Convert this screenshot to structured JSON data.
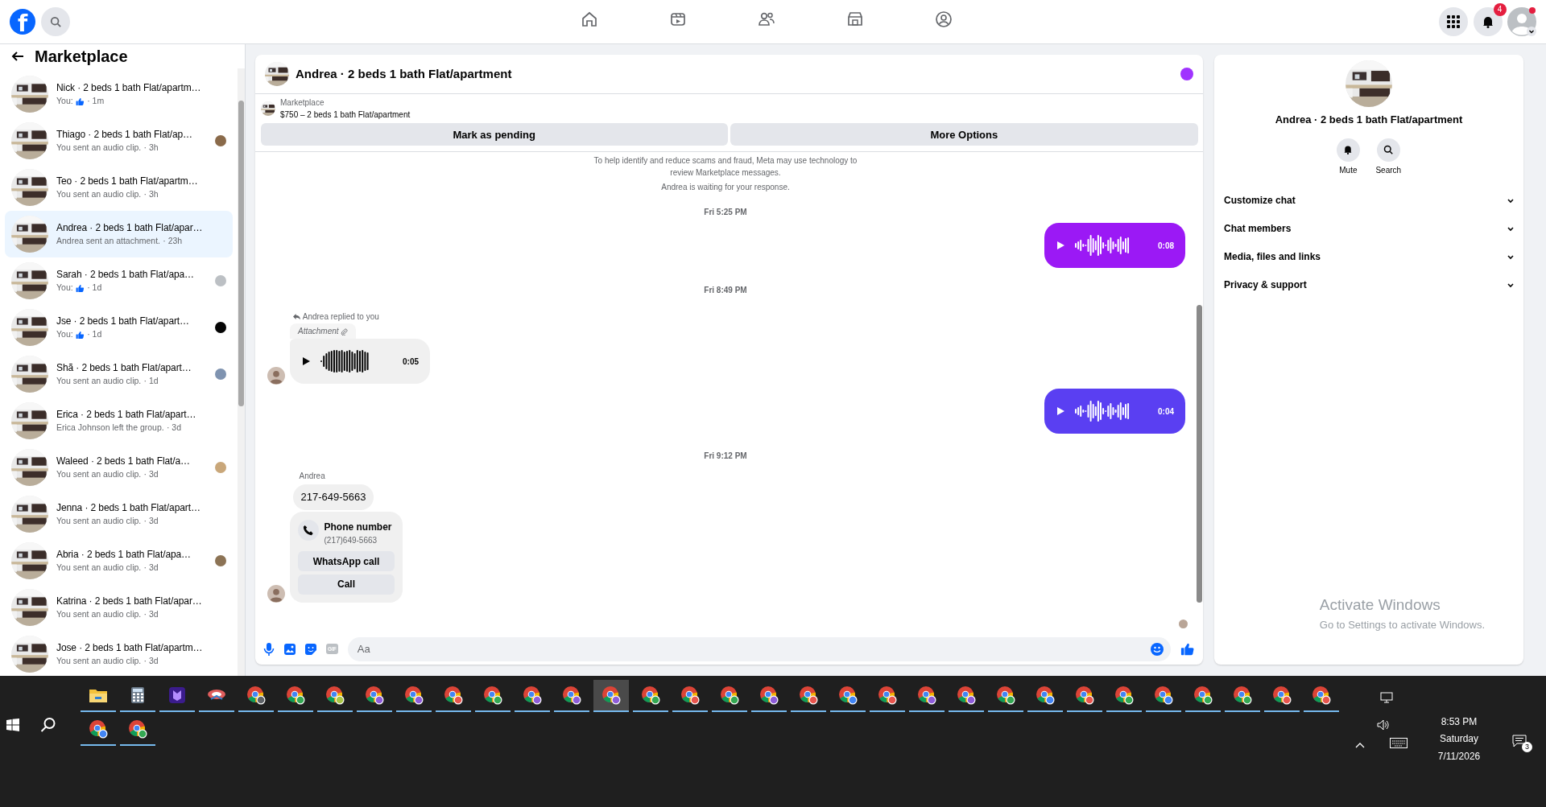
{
  "top_bar": {
    "logo": "f",
    "notification_count": "4"
  },
  "sidebar": {
    "title": "Marketplace",
    "conversations": [
      {
        "title": "Nick · 2 beds 1 bath Flat/apartm…",
        "preview": "You:",
        "like": true,
        "time": "· 1m",
        "selected": false
      },
      {
        "title": "Thiago · 2 beds 1 bath Flat/ap…",
        "preview": "You sent an audio clip.",
        "like": false,
        "time": "· 3h",
        "selected": false,
        "color": "#8a6a4a"
      },
      {
        "title": "Teo · 2 beds 1 bath Flat/apartm…",
        "preview": "You sent an audio clip.",
        "like": false,
        "time": "· 3h",
        "selected": false
      },
      {
        "title": "Andrea · 2 beds 1 bath Flat/apar…",
        "preview": "Andrea sent an attachment.",
        "like": false,
        "time": "· 23h",
        "selected": true
      },
      {
        "title": "Sarah · 2 beds 1 bath Flat/apa…",
        "preview": "You:",
        "like": true,
        "time": "· 1d",
        "selected": false,
        "color": "#bcc0c4"
      },
      {
        "title": "Jse · 2 beds 1 bath Flat/apart…",
        "preview": "You:",
        "like": true,
        "time": "· 1d",
        "selected": false,
        "color": "#050505"
      },
      {
        "title": "Shã · 2 beds 1 bath Flat/apart…",
        "preview": "You sent an audio clip.",
        "like": false,
        "time": "· 1d",
        "selected": false,
        "color": "#7f93b0"
      },
      {
        "title": "Erica · 2 beds 1 bath Flat/apart…",
        "preview": "Erica Johnson left the group.",
        "like": false,
        "time": "· 3d",
        "selected": false
      },
      {
        "title": "Waleed · 2 beds 1 bath Flat/a…",
        "preview": "You sent an audio clip.",
        "like": false,
        "time": "· 3d",
        "selected": false,
        "color": "#c9a77a"
      },
      {
        "title": "Jenna · 2 beds 1 bath Flat/apart…",
        "preview": "You sent an audio clip.",
        "like": false,
        "time": "· 3d",
        "selected": false
      },
      {
        "title": "Abria · 2 beds 1 bath Flat/apa…",
        "preview": "You sent an audio clip.",
        "like": false,
        "time": "· 3d",
        "selected": false,
        "color": "#8c7355"
      },
      {
        "title": "Katrina · 2 beds 1 bath Flat/apar…",
        "preview": "You sent an audio clip.",
        "like": false,
        "time": "· 3d",
        "selected": false
      },
      {
        "title": "Jose · 2 beds 1 bath Flat/apartm…",
        "preview": "You sent an audio clip.",
        "like": false,
        "time": "· 3d",
        "selected": false
      }
    ]
  },
  "chat": {
    "title": "Andrea · 2 beds 1 bath Flat/apartment",
    "listing_label": "Marketplace",
    "listing": "$750 – 2 beds 1 bath Flat/apartment",
    "buttons": [
      "Mark as pending",
      "More Options"
    ],
    "messages": [
      {
        "kind": "notice",
        "text": "To help identify and reduce scams and fraud, Meta may use technology to review Marketplace messages."
      },
      {
        "kind": "notice",
        "text": "Andrea is waiting for your response."
      },
      {
        "kind": "date",
        "text": "Fri 5:25 PM"
      },
      {
        "kind": "voice",
        "outgoing": true,
        "color": "#9b19f5",
        "duration": "0:08"
      },
      {
        "kind": "date",
        "text": "Fri 8:49 PM"
      },
      {
        "kind": "reply_label",
        "text": "Andrea replied to you"
      },
      {
        "kind": "voice",
        "outgoing": false,
        "attachment_label": "Attachment",
        "duration": "0:05",
        "avatar": true
      },
      {
        "kind": "voice",
        "outgoing": true,
        "color": "#5a3ff2",
        "duration": "0:04"
      },
      {
        "kind": "date",
        "text": "Fri 9:12 PM"
      },
      {
        "kind": "sender",
        "text": "Andrea"
      },
      {
        "kind": "text",
        "text": "217-649-5663"
      },
      {
        "kind": "phone_card",
        "title": "Phone number",
        "number": "(217)649-5663",
        "buttons": [
          "WhatsApp call",
          "Call"
        ],
        "avatar": true
      }
    ],
    "seen_avatar": true,
    "composer": {
      "gif_label": "GIF",
      "placeholder": "Aa"
    }
  },
  "details": {
    "title": "Andrea · 2 beds 1 bath Flat/apartment",
    "actions": [
      {
        "kind": "mute",
        "label": "Mute"
      },
      {
        "kind": "search",
        "label": "Search"
      }
    ],
    "sections": [
      {
        "label": "Customize chat",
        "expanded": false
      },
      {
        "label": "Chat members",
        "expanded": false
      },
      {
        "label": "Media, files and links",
        "expanded": false
      },
      {
        "label": "Privacy & support",
        "expanded": false
      }
    ]
  },
  "activation": {
    "title": "Activate Windows",
    "text": "Go to Settings to activate Windows."
  },
  "taskbar": {
    "apps": [
      {
        "kind": "explorer",
        "selected": false
      },
      {
        "kind": "calculator",
        "selected": false
      },
      {
        "kind": "app",
        "selected": false
      },
      {
        "kind": "app2",
        "selected": false
      },
      {
        "kind": "browser",
        "color": "#5f6368",
        "selected": false
      },
      {
        "kind": "browser",
        "color": "#34a853",
        "selected": false
      },
      {
        "kind": "browser",
        "color": "#a8c545",
        "selected": false
      },
      {
        "kind": "browser",
        "color": "#8e5cd9",
        "selected": false
      },
      {
        "kind": "browser",
        "color": "#8e5cd9",
        "selected": false
      },
      {
        "kind": "browser",
        "color": "#e8554e",
        "selected": false
      },
      {
        "kind": "browser",
        "color": "#34a853",
        "selected": false
      },
      {
        "kind": "browser",
        "color": "#8e5cd9",
        "selected": false
      },
      {
        "kind": "browser",
        "color": "#8e5cd9",
        "selected": false
      },
      {
        "kind": "browser",
        "color": "#8e5cd9",
        "selected": true
      },
      {
        "kind": "browser",
        "color": "#34a853",
        "selected": false
      },
      {
        "kind": "browser",
        "color": "#e8554e",
        "selected": false
      },
      {
        "kind": "browser",
        "color": "#34a853",
        "selected": false
      },
      {
        "kind": "browser",
        "color": "#8e5cd9",
        "selected": false
      },
      {
        "kind": "browser",
        "color": "#e8554e",
        "selected": false
      },
      {
        "kind": "browser",
        "color": "#4285f4",
        "selected": false
      },
      {
        "kind": "browser",
        "color": "#e8554e",
        "selected": false
      },
      {
        "kind": "browser",
        "color": "#8e5cd9",
        "selected": false
      },
      {
        "kind": "browser",
        "color": "#8e5cd9",
        "selected": false
      },
      {
        "kind": "browser",
        "color": "#34a853",
        "selected": false
      },
      {
        "kind": "browser",
        "color": "#4285f4",
        "selected": false
      },
      {
        "kind": "browser",
        "color": "#e8554e",
        "selected": false
      },
      {
        "kind": "browser",
        "color": "#34a853",
        "selected": false
      },
      {
        "kind": "browser",
        "color": "#4285f4",
        "selected": false
      },
      {
        "kind": "browser",
        "color": "#34a853",
        "selected": false
      },
      {
        "kind": "browser",
        "color": "#34a853",
        "selected": false
      },
      {
        "kind": "browser",
        "color": "#e8554e",
        "selected": false
      },
      {
        "kind": "browser",
        "color": "#e8554e",
        "selected": false
      },
      {
        "kind": "browser",
        "color": "#4285f4",
        "selected": false
      },
      {
        "kind": "browser",
        "color": "#34a853",
        "selected": false
      }
    ],
    "time": "8:53 PM",
    "day": "Saturday",
    "date": "7/11/2026",
    "notifications": "3"
  }
}
